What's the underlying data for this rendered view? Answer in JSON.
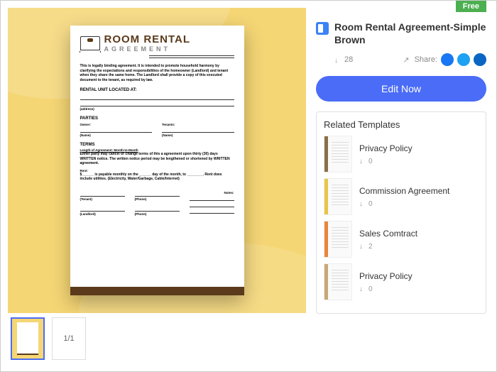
{
  "badge": "Free",
  "template": {
    "title": "Room Rental Agreement-Simple Brown",
    "downloads": "28",
    "share_label": "Share:",
    "edit_button": "Edit Now"
  },
  "pagination": {
    "text": "1/1"
  },
  "related": {
    "title": "Related Templates",
    "items": [
      {
        "name": "Privacy Policy",
        "downloads": "0",
        "color": "brown"
      },
      {
        "name": "Commission Agreement",
        "downloads": "0",
        "color": "yellow"
      },
      {
        "name": "Sales Comtract",
        "downloads": "2",
        "color": "orange"
      },
      {
        "name": "Privacy Policy",
        "downloads": "0",
        "color": "tan"
      }
    ]
  },
  "document": {
    "heading1": "ROOM RENTAL",
    "heading2": "AGREEMENT",
    "intro": "This is legally binding agreement. It is intended to promote household harmony by clarifying the expectations and responsibilities of the homeowner (Landlord) and tenant when they share the same home. The Landlord shall provide a copy of this executed document to the tenant, as required by law.",
    "rental_unit": "RENTAL UNIT LOCATED AT:",
    "address": "(address)",
    "parties": "PARTIES",
    "owner": "Owner:",
    "tenants": "Tenants:",
    "name": "(Name)",
    "terms": "TERMS",
    "length": "Length of Agreement: Month-to-Month",
    "length_body": "Either party may cancel or change terms of this a agreement upon thirty (30) days WRITTEN notice. The written notice period may be lengthened or shortened by WRITTEN agreement.",
    "rent": "Rent:",
    "rent_body": "$______ is payable monthly on the ______ day of the month, to ________. Rent does include utilities. (Electricity, Water/Garbage, Cable/Internet)",
    "tenant_sig": "(Tenant)",
    "landlord_sig": "(Landlord)",
    "phone": "(Phone)",
    "notes": "Notes:"
  }
}
